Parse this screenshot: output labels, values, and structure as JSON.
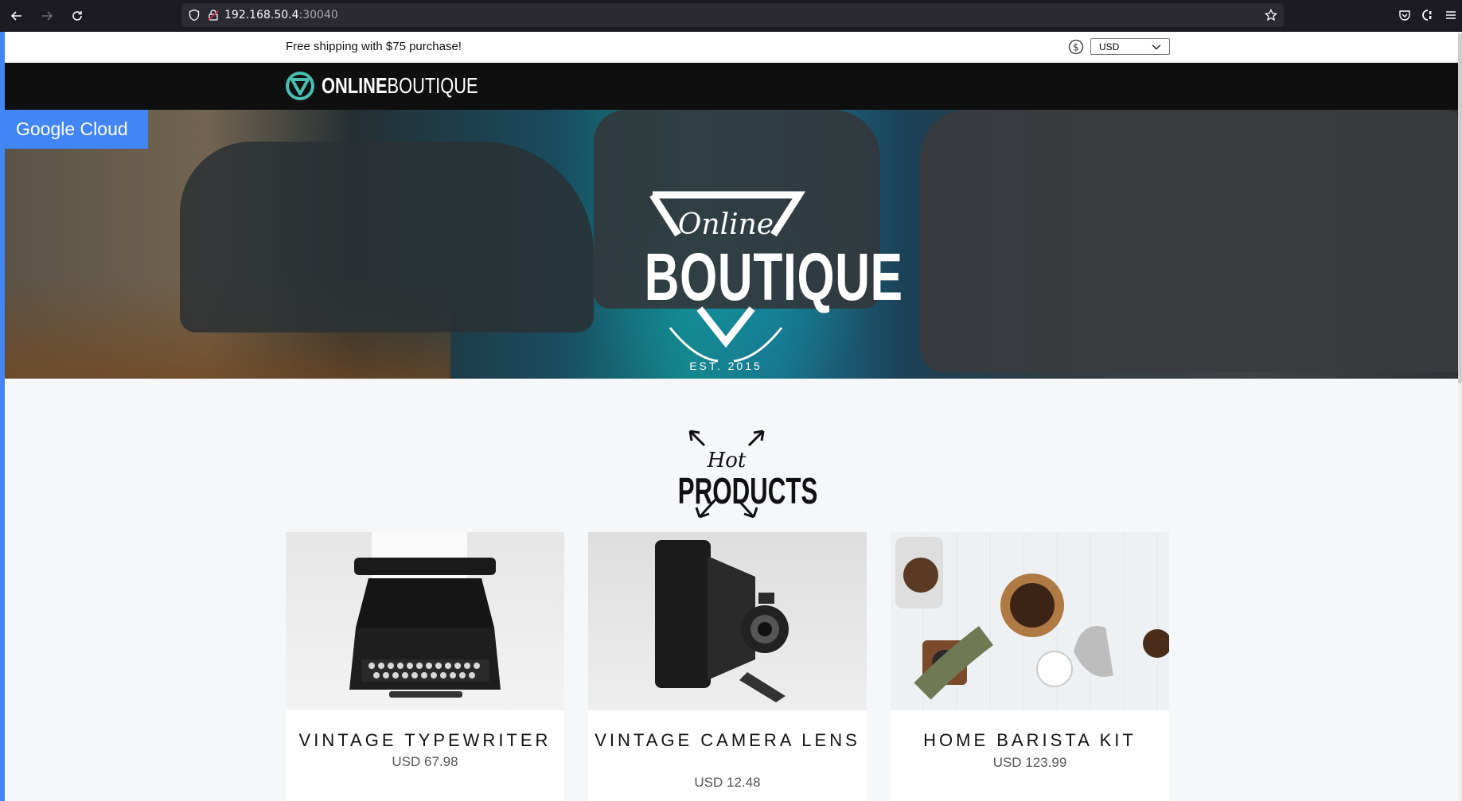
{
  "browser": {
    "url_host": "192.168.50.4",
    "url_port": ":30040"
  },
  "site": {
    "shipping_banner": "Free shipping with $75 purchase!",
    "currency_selected": "USD",
    "logo_bold": "ONLINE",
    "logo_light": "BOUTIQUE",
    "google_badge": "Google Cloud",
    "hero": {
      "line1": "Online",
      "line2": "BOUTIQUE",
      "est": "EST. 2015"
    },
    "section": {
      "hot": "Hot",
      "products": "PRODUCTS"
    },
    "products": [
      {
        "name": "VINTAGE TYPEWRITER",
        "price": "USD 67.98"
      },
      {
        "name": "VINTAGE CAMERA LENS",
        "price": "USD 12.48"
      },
      {
        "name": "HOME BARISTA KIT",
        "price": "USD 123.99"
      }
    ]
  },
  "colors": {
    "accent": "#4285f4",
    "header_bg": "#0f0f0f",
    "logo_teal": "#49bfb1"
  }
}
